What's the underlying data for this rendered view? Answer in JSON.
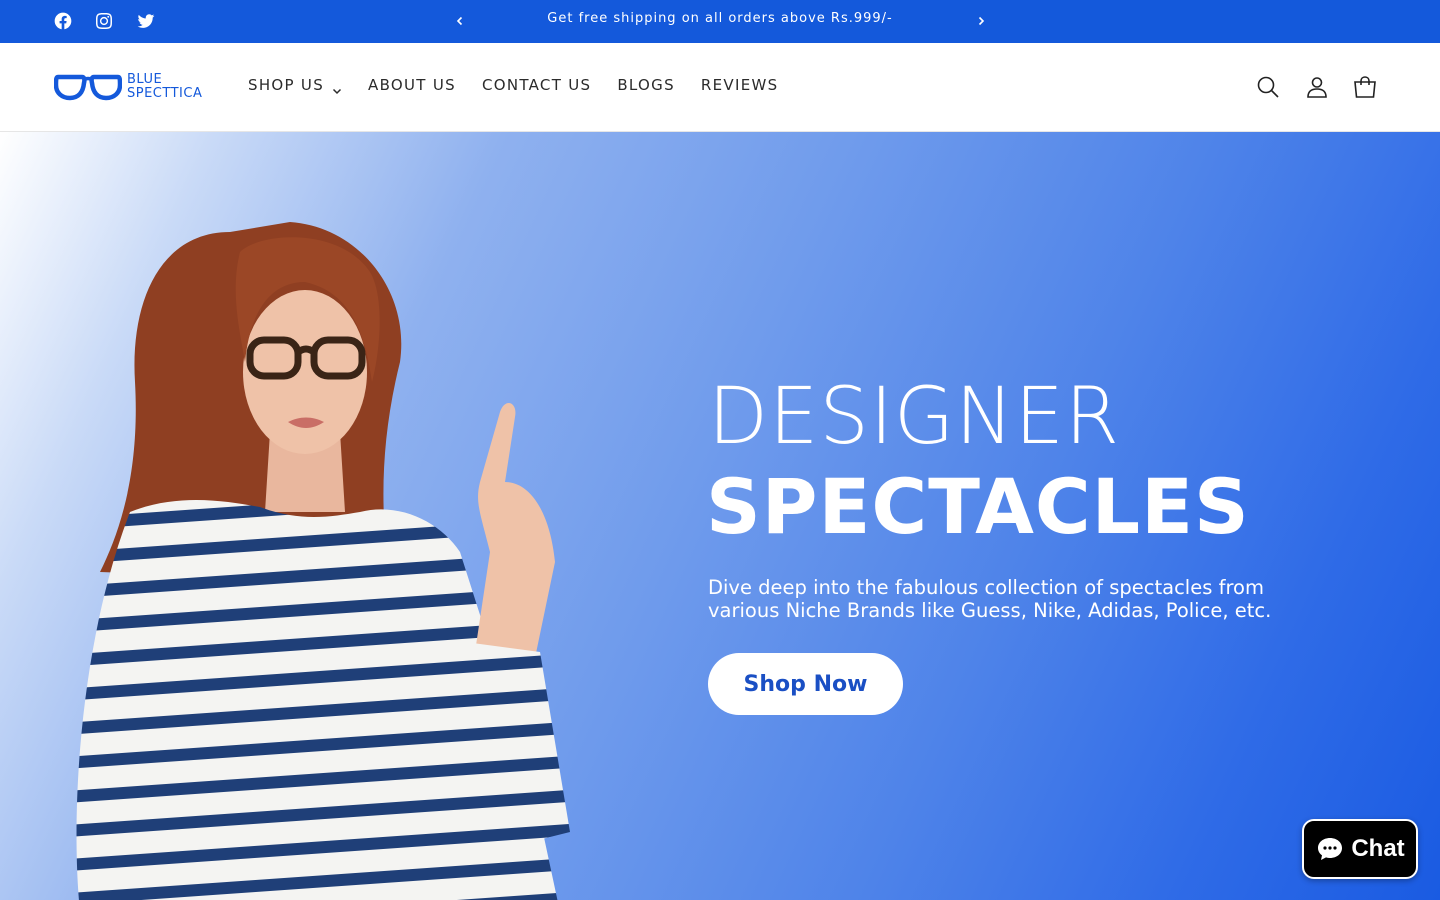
{
  "announcement": {
    "text": "Get free shipping on all orders above Rs.999/-",
    "social": [
      "facebook-icon",
      "instagram-icon",
      "twitter-icon"
    ],
    "prev_icon": "chevron-left-icon",
    "next_icon": "chevron-right-icon",
    "background": "#1459db"
  },
  "header": {
    "logo": {
      "line1": "BLUE",
      "line2": "SPECTTICA",
      "icon": "glasses-logo-icon"
    },
    "nav": [
      {
        "label": "SHOP US",
        "has_dropdown": true
      },
      {
        "label": "ABOUT US"
      },
      {
        "label": "CONTACT US"
      },
      {
        "label": "BLOGS"
      },
      {
        "label": "REVIEWS"
      }
    ],
    "icons": [
      "search-icon",
      "account-icon",
      "cart-icon"
    ]
  },
  "hero": {
    "title_line1": "DESIGNER",
    "title_line2": "SPECTACLES",
    "subtitle_line1": "Dive deep into the fabulous collection of spectacles from",
    "subtitle_line2": "various Niche Brands like Guess, Nike, Adidas, Police, etc.",
    "cta": "Shop Now",
    "image": "woman-wearing-glasses-striped-shirt"
  },
  "chat": {
    "label": "Chat",
    "icon": "chat-bubble-icon"
  },
  "colors": {
    "brand": "#1459db",
    "hero_gradient_end": "#1a5be2",
    "cta_text": "#1a4fc4"
  }
}
